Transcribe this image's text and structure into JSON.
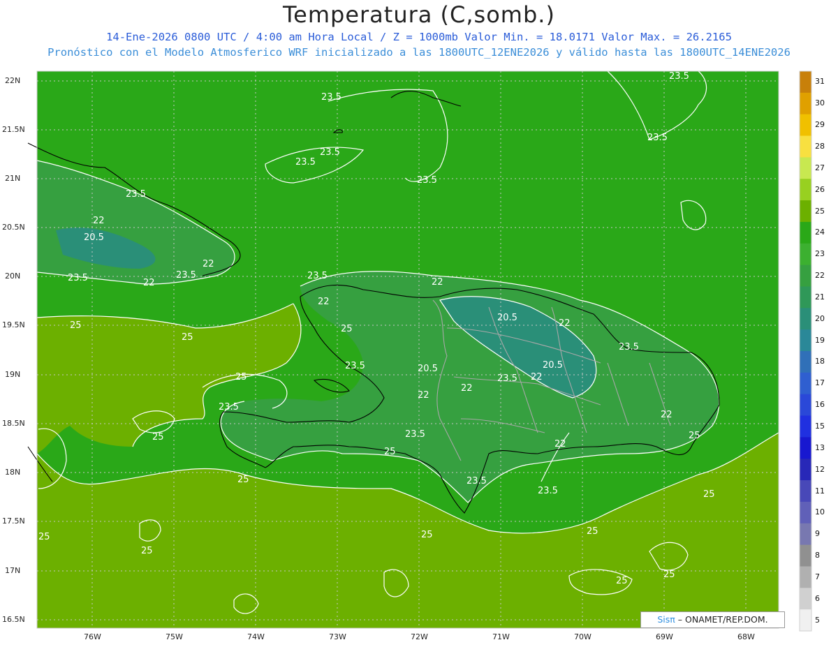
{
  "header": {
    "title": "Temperatura (C,somb.)",
    "line1": "14-Ene-2026  0800 UTC / 4:00 am Hora Local / Z = 1000mb   Valor Min. = 18.0171  Valor Max. = 26.2165",
    "line2": "Pronóstico con el Modelo Atmosferico WRF inicializado a las 1800UTC_12ENE2026 y válido hasta las  1800UTC_14ENE2026"
  },
  "axes": {
    "lat_labels": [
      "22N",
      "21.5N",
      "21N",
      "20.5N",
      "20N",
      "19.5N",
      "19N",
      "18.5N",
      "18N",
      "17.5N",
      "17N",
      "16.5N"
    ],
    "lon_labels": [
      "76W",
      "75W",
      "74W",
      "73W",
      "72W",
      "71W",
      "70W",
      "69W",
      "68W"
    ]
  },
  "colorbar": {
    "labels": [
      "31",
      "30",
      "29",
      "28",
      "27",
      "26",
      "25",
      "24",
      "23",
      "22",
      "21",
      "20",
      "19",
      "18",
      "17",
      "16",
      "15",
      "13",
      "12",
      "11",
      "10",
      "9",
      "8",
      "7",
      "6",
      "5"
    ],
    "colors": [
      "#c8800a",
      "#e0a000",
      "#f0c000",
      "#f8e040",
      "#c8e850",
      "#98d020",
      "#6cb000",
      "#2aa818",
      "#3cb030",
      "#36a040",
      "#2f9858",
      "#2a8f78",
      "#2a8898",
      "#3070b8",
      "#2f5fd0",
      "#2a48d8",
      "#2030e0",
      "#1818d0",
      "#2828b8",
      "#4848b8",
      "#6060b8",
      "#7878b0",
      "#909090",
      "#b0b0b0",
      "#d0d0d0",
      "#f0f0f0"
    ]
  },
  "contour_labels": [
    {
      "text": "23.5"
    },
    {
      "text": "23.5"
    },
    {
      "text": "23.5"
    },
    {
      "text": "23.5"
    },
    {
      "text": "23.5"
    },
    {
      "text": "23.5"
    },
    {
      "text": "22"
    },
    {
      "text": "20.5"
    },
    {
      "text": "23.5"
    },
    {
      "text": "22"
    },
    {
      "text": "23.5"
    },
    {
      "text": "25"
    },
    {
      "text": "25"
    },
    {
      "text": "23.5"
    },
    {
      "text": "22"
    },
    {
      "text": "22"
    },
    {
      "text": "22"
    },
    {
      "text": "20.5"
    },
    {
      "text": "22"
    },
    {
      "text": "25"
    },
    {
      "text": "23.5"
    },
    {
      "text": "20.5"
    },
    {
      "text": "23.5"
    },
    {
      "text": "22"
    },
    {
      "text": "20.5"
    },
    {
      "text": "22"
    },
    {
      "text": "23.5"
    },
    {
      "text": "25"
    },
    {
      "text": "22"
    },
    {
      "text": "23.5"
    },
    {
      "text": "25"
    },
    {
      "text": "23.5"
    },
    {
      "text": "25"
    },
    {
      "text": "22"
    },
    {
      "text": "22"
    },
    {
      "text": "23.5"
    },
    {
      "text": "25"
    },
    {
      "text": "23.5"
    },
    {
      "text": "23.5"
    },
    {
      "text": "25"
    },
    {
      "text": "25"
    },
    {
      "text": "25"
    },
    {
      "text": "25"
    },
    {
      "text": "25"
    },
    {
      "text": "25"
    },
    {
      "text": "25"
    },
    {
      "text": "25"
    }
  ],
  "branding": {
    "logo": "Sisπ",
    "text": "– ONAMET/REP.DOM."
  }
}
